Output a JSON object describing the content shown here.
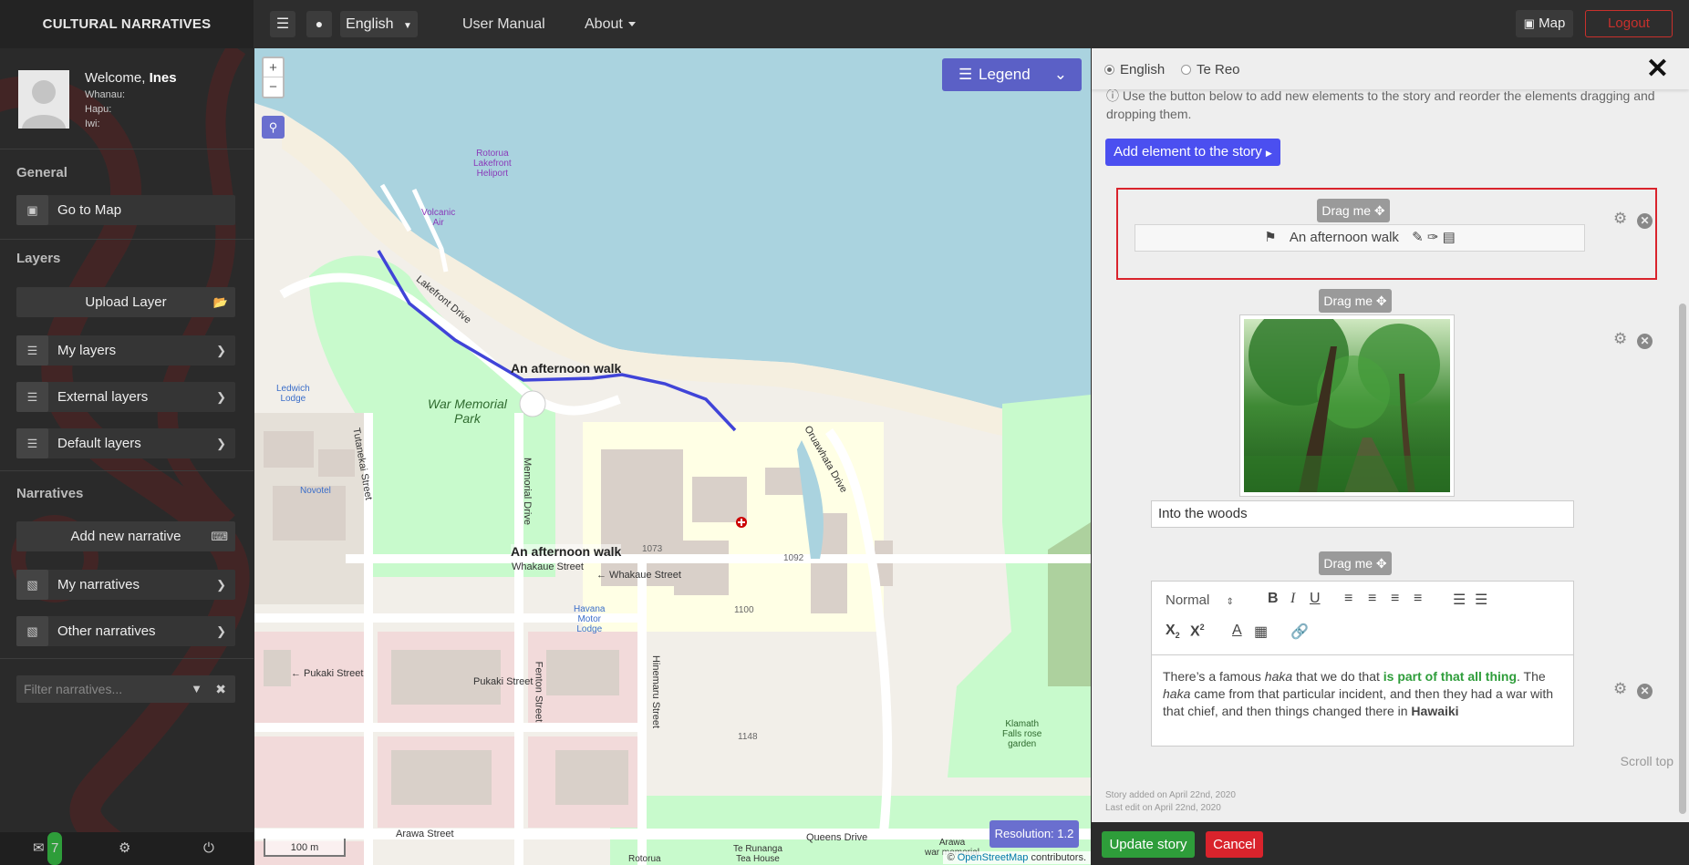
{
  "topbar": {
    "brand": "CULTURAL NARRATIVES",
    "language": "English",
    "user_manual": "User Manual",
    "about": "About",
    "map": "Map",
    "logout": "Logout"
  },
  "sidebar": {
    "welcome_prefix": "Welcome,",
    "user_name": "Ines",
    "whanau": "Whanau:",
    "hapu": "Hapu:",
    "iwi": "Iwi:",
    "general_title": "General",
    "go_to_map": "Go to Map",
    "layers_title": "Layers",
    "upload_layer": "Upload Layer",
    "my_layers": "My layers",
    "external_layers": "External layers",
    "default_layers": "Default layers",
    "narratives_title": "Narratives",
    "add_new_narrative": "Add new narrative",
    "my_narratives": "My narratives",
    "other_narratives": "Other narratives",
    "filter_placeholder": "Filter narratives...",
    "messages_count": "7"
  },
  "map": {
    "legend": "Legend",
    "resolution": "Resolution: 1.2",
    "scale": "100 m",
    "attribution_prefix": "©",
    "attribution_link": "OpenStreetMap",
    "attribution_suffix": "contributors.",
    "route_label": "An afternoon walk",
    "labels": {
      "rotorua_heliport": "Rotorua\nLakefront\nHeliport",
      "volcanic_air": "Volcanic\nAir",
      "lakefront_drive": "Lakefront Drive",
      "war_memorial_park": "War Memorial\nPark",
      "ledwich_lodge": "Ledwich\nLodge",
      "tutanekai_street": "Tutanekai Street",
      "memorial_drive": "Memorial Drive",
      "oruawhata_drive": "Oruawhata Drive",
      "novotel": "Novotel",
      "whakaue_street": "Whakaue Street",
      "whakaue_street2": "← Whakaue Street",
      "havana_motor_lodge": "Havana\nMotor\nLodge",
      "pukaki_street": "← Pukaki Street",
      "pukaki_street2": "Pukaki Street",
      "fenton_street": "Fenton Street",
      "hinemaru_street": "Hinemaru Street",
      "arawa_street": "Arawa Street",
      "queens_drive": "Queens Drive",
      "klamath_falls": "Klamath\nFalls rose\ngarden",
      "arawa_war_memorial": "Arawa\nwar memorial",
      "te_runanga": "Te Runanga\nTea House",
      "rotorua": "Rotorua",
      "n1073": "1073",
      "n1092": "1092",
      "n1100": "1100",
      "n1148": "1148"
    }
  },
  "panel": {
    "lang_english": "English",
    "lang_tereo": "Te Reo",
    "info": "Use the button below to add new elements to the story and reorder the elements dragging and dropping them.",
    "add_element": "Add element to the story",
    "drag_me": "Drag me",
    "walk_title": "An afternoon walk",
    "caption": "Into the woods",
    "editor_format": "Normal",
    "editor_text": {
      "p1": "There’s a famous ",
      "haka1": "haka",
      "p2": " that we do that ",
      "highlight": "is part of that all thing",
      "p3": ". The ",
      "haka2": "haka",
      "p4": " came from that particular incident, and then they had a war with that chief, and then things changed there in ",
      "hawaiki": "Hawaiki"
    },
    "scroll_top": "Scroll top",
    "story_added": "Story added on April 22nd, 2020",
    "last_edit": "Last edit on April 22nd, 2020",
    "update_story": "Update story",
    "cancel": "Cancel"
  },
  "colors": {
    "accent_blue": "#4b4ff0",
    "route": "#4044d8",
    "success": "#2e9d3a",
    "danger": "#d9232c",
    "water": "#aad3df",
    "park": "#c8facc"
  }
}
